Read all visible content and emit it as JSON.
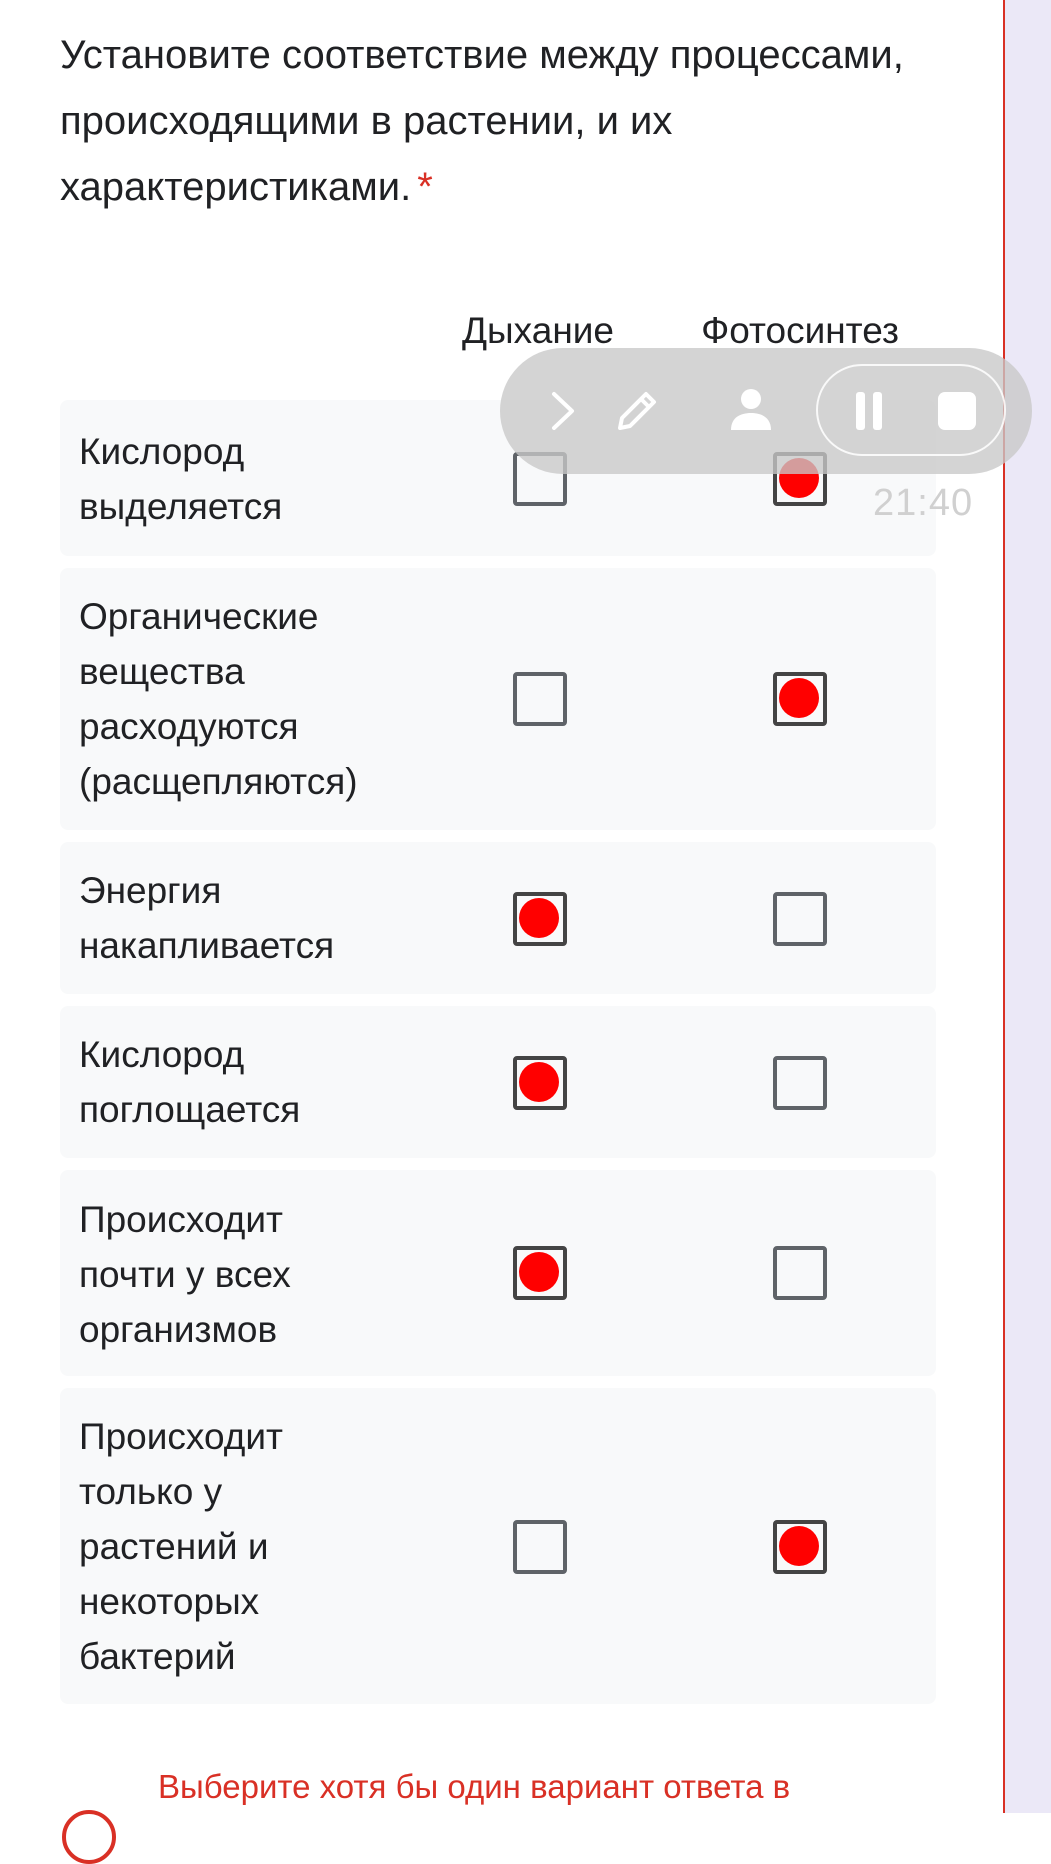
{
  "question": {
    "title": "Установите соответствие между процессами, происходящими в растении, и их характеристиками.",
    "required_mark": "*"
  },
  "columns": [
    "Дыхание",
    "Фотосинтез"
  ],
  "rows": [
    {
      "label": "Кислород\nвыделяется",
      "checked": [
        false,
        true
      ]
    },
    {
      "label": "Органические\nвещества\nрасходуются\n(расщепляются)",
      "checked": [
        false,
        true
      ]
    },
    {
      "label": "Энергия\nнакапливается",
      "checked": [
        true,
        false
      ]
    },
    {
      "label": "Кислород\nпоглощается",
      "checked": [
        true,
        false
      ]
    },
    {
      "label": "Происходит\nпочти у всех\nорганизмов",
      "checked": [
        true,
        false
      ]
    },
    {
      "label": "Происходит\nтолько у\nрастений и\nнекоторых\nбактерий",
      "checked": [
        false,
        true
      ]
    }
  ],
  "recorder_toolbar": {
    "icons": [
      "chevron-right-icon",
      "pencil-icon",
      "person-icon",
      "pause-icon",
      "stop-icon"
    ],
    "timer": "21:40"
  },
  "validation": {
    "message": "Выберите хотя бы один вариант ответа в"
  },
  "colors": {
    "accent_error": "#d93025",
    "mark": "#ff0000",
    "row_background": "#f8f9fa"
  }
}
